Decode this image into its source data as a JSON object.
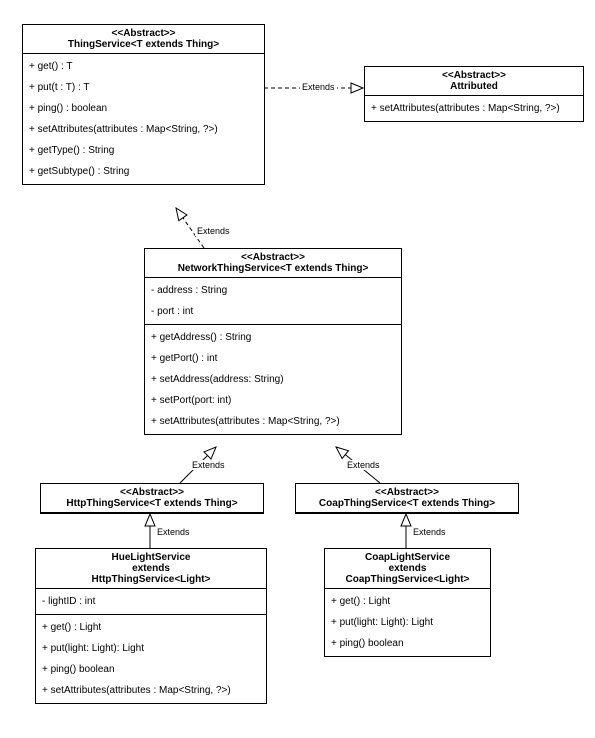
{
  "stereo": "<<Abstract>>",
  "thingService": {
    "title": "ThingService<T extends Thing>",
    "m": [
      "+ get() : T",
      "+ put(t : T) : T",
      "+ ping() : boolean",
      "+ setAttributes(attributes : Map<String, ?>)",
      "+ getType() : String",
      "+ getSubtype() : String"
    ]
  },
  "attributed": {
    "title": "Attributed",
    "m": [
      "+ setAttributes(attributes : Map<String, ?>)"
    ]
  },
  "network": {
    "title": "NetworkThingService<T extends Thing>",
    "a": [
      "- address : String",
      "- port : int"
    ],
    "m": [
      "+ getAddress() : String",
      "+ getPort() : int",
      "+ setAddress(address: String)",
      "+ setPort(port: int)",
      "+ setAttributes(attributes : Map<String, ?>)"
    ]
  },
  "http": {
    "title": "HttpThingService<T extends Thing>"
  },
  "coap": {
    "title": "CoapThingService<T extends Thing>"
  },
  "hue": {
    "title": "HueLightService",
    "ext": "extends",
    "sup": "HttpThingService<Light>",
    "a": [
      "- lightID : int"
    ],
    "m": [
      "+ get() : Light",
      "+ put(light: Light): Light",
      "+ ping() boolean",
      "+ setAttributes(attributes : Map<String, ?>)"
    ]
  },
  "coapLight": {
    "title": "CoapLightService",
    "ext": "extends",
    "sup": "CoapThingService<Light>",
    "m": [
      "+ get() : Light",
      "+ put(light: Light): Light",
      "+ ping() boolean"
    ]
  },
  "extLabel": "Extends"
}
